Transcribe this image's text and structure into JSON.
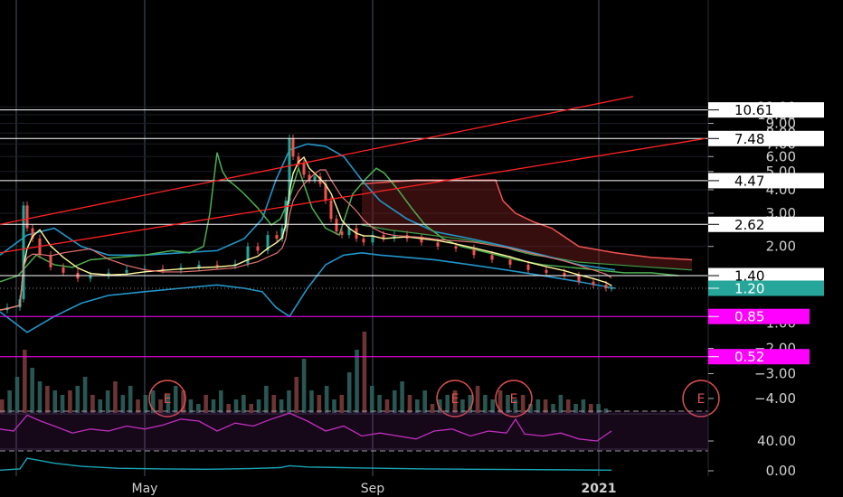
{
  "chart_data": {
    "type": "line",
    "title": "",
    "xlabel": "",
    "ylabel": "",
    "x_ticks": [
      "May",
      "Sep",
      "2021"
    ],
    "price_axis": {
      "scale": "log",
      "tick_labels": [
        "11.00",
        "10.00",
        "9.00",
        "8.00",
        "7.00",
        "6.00",
        "5.00",
        "4.00",
        "3.00",
        "2.00"
      ],
      "negative_tick_labels": [
        "−1.00",
        "−2.00",
        "−3.00",
        "−4.00"
      ]
    },
    "rsi_axis": {
      "tick_labels": [
        "40.00"
      ]
    },
    "lower_axis": {
      "tick_labels": [
        "0.00"
      ]
    },
    "horizontal_levels": [
      {
        "label": "10.61",
        "value": 10.61,
        "style": "white"
      },
      {
        "label": "7.48",
        "value": 7.48,
        "style": "white"
      },
      {
        "label": "4.47",
        "value": 4.47,
        "style": "white"
      },
      {
        "label": "2.62",
        "value": 2.62,
        "style": "white"
      },
      {
        "label": "1.40",
        "value": 1.4,
        "style": "white"
      },
      {
        "label": "1.20",
        "value": 1.2,
        "style": "teal"
      },
      {
        "label": "0.85",
        "value": 0.85,
        "style": "magenta"
      },
      {
        "label": "0.52",
        "value": 0.52,
        "style": "magenta"
      }
    ],
    "earnings_markers": [
      "E",
      "E",
      "E",
      "E"
    ],
    "price_series": {
      "name": "",
      "x": [
        0,
        8,
        22,
        26,
        30,
        36,
        44,
        56,
        70,
        86,
        100,
        120,
        140,
        160,
        180,
        200,
        220,
        240,
        260,
        274,
        285,
        296,
        306,
        312,
        316,
        320,
        324,
        330,
        336,
        342,
        348,
        354,
        360,
        366,
        372,
        378,
        386,
        394,
        402,
        412,
        424,
        436,
        450,
        466,
        484,
        504,
        524,
        544,
        564,
        584,
        604,
        624,
        640,
        656,
        670,
        676
      ],
      "values": [
        0.92,
        0.95,
        1.05,
        3.3,
        2.5,
        2.2,
        1.8,
        1.55,
        1.45,
        1.35,
        1.4,
        1.45,
        1.5,
        1.52,
        1.5,
        1.55,
        1.6,
        1.58,
        1.62,
        2.0,
        1.9,
        2.3,
        2.2,
        2.5,
        3.5,
        7.48,
        6.0,
        5.5,
        4.8,
        4.5,
        4.7,
        4.3,
        3.5,
        2.8,
        2.4,
        2.3,
        2.5,
        2.2,
        2.1,
        2.3,
        2.2,
        2.3,
        2.2,
        2.1,
        2.0,
        1.95,
        1.8,
        1.7,
        1.6,
        1.5,
        1.45,
        1.4,
        1.3,
        1.25,
        1.2,
        1.2
      ]
    },
    "green_series": {
      "name": "",
      "x": [
        0,
        20,
        40,
        60,
        80,
        100,
        130,
        160,
        190,
        210,
        225,
        232,
        240,
        246,
        252,
        260,
        270,
        285,
        300,
        310,
        320,
        330,
        345,
        360,
        375,
        390,
        405,
        416,
        425,
        440,
        455,
        470,
        490,
        510,
        530,
        550,
        570,
        600,
        630,
        660,
        690,
        720,
        750
      ],
      "values": [
        1.3,
        1.4,
        1.8,
        1.6,
        1.55,
        1.7,
        1.75,
        1.8,
        1.9,
        1.85,
        2.0,
        3.0,
        6.3,
        5.0,
        4.5,
        4.2,
        3.8,
        3.2,
        2.6,
        2.8,
        3.6,
        5.2,
        3.2,
        2.5,
        2.3,
        3.8,
        4.6,
        5.2,
        4.9,
        4.0,
        3.2,
        2.6,
        2.2,
        2.0,
        1.9,
        1.8,
        1.7,
        1.6,
        1.55,
        1.5,
        1.45,
        1.45,
        1.4
      ]
    },
    "cloud_series": {
      "name": "",
      "x": [
        400,
        430,
        460,
        490,
        520,
        548,
        556,
        570,
        590,
        610,
        640,
        680,
        720,
        765
      ],
      "upper": [
        4.3,
        4.4,
        4.5,
        4.5,
        4.5,
        4.5,
        3.5,
        3.0,
        2.7,
        2.5,
        2.0,
        1.85,
        1.75,
        1.7
      ],
      "lower": [
        2.6,
        2.45,
        2.35,
        2.25,
        2.15,
        2.05,
        2.0,
        1.9,
        1.8,
        1.75,
        1.65,
        1.6,
        1.55,
        1.5
      ]
    },
    "band_series": {
      "name": "",
      "x": [
        0,
        30,
        60,
        90,
        120,
        160,
        200,
        240,
        270,
        290,
        305,
        320,
        340,
        360,
        380,
        400,
        420,
        450,
        480,
        520,
        560,
        600,
        640,
        680
      ],
      "upper": [
        1.8,
        2.3,
        2.5,
        2.0,
        1.8,
        1.8,
        1.85,
        1.9,
        2.2,
        2.8,
        4.5,
        6.5,
        7.0,
        6.8,
        6.0,
        4.5,
        3.5,
        2.8,
        2.4,
        2.2,
        2.0,
        1.8,
        1.6,
        1.5
      ],
      "lower": [
        0.9,
        0.7,
        0.85,
        1.0,
        1.1,
        1.15,
        1.2,
        1.25,
        1.2,
        1.15,
        0.95,
        0.85,
        1.2,
        1.6,
        1.8,
        1.85,
        1.8,
        1.75,
        1.7,
        1.6,
        1.5,
        1.4,
        1.3,
        1.2
      ]
    },
    "trend_lines": [
      {
        "from": [
          0,
          2.62
        ],
        "to": [
          700,
          12.5
        ]
      },
      {
        "from": [
          0,
          1.85
        ],
        "to": [
          780,
          7.48
        ]
      }
    ],
    "rsi_levels": [
      70,
      30
    ],
    "rsi_series": {
      "name": "",
      "x": [
        0,
        15,
        30,
        45,
        60,
        80,
        100,
        120,
        140,
        160,
        180,
        200,
        220,
        240,
        260,
        280,
        300,
        320,
        340,
        360,
        380,
        400,
        420,
        440,
        460,
        480,
        500,
        520,
        540,
        560,
        570,
        580,
        600,
        620,
        640,
        660,
        676
      ],
      "values": [
        52,
        50,
        66,
        60,
        55,
        48,
        52,
        50,
        55,
        52,
        56,
        62,
        60,
        50,
        58,
        55,
        62,
        68,
        60,
        50,
        55,
        45,
        48,
        45,
        42,
        50,
        52,
        45,
        50,
        48,
        62,
        47,
        45,
        48,
        42,
        40,
        50
      ]
    },
    "lower_series": {
      "name": "",
      "x": [
        0,
        22,
        30,
        60,
        90,
        130,
        180,
        230,
        280,
        310,
        320,
        340,
        380,
        420,
        470,
        520,
        570,
        620,
        676
      ],
      "values": [
        0.05,
        0.15,
        1.0,
        0.6,
        0.35,
        0.2,
        0.15,
        0.12,
        0.18,
        0.25,
        0.4,
        0.3,
        0.25,
        0.2,
        0.15,
        0.12,
        0.1,
        0.08,
        0.05
      ]
    },
    "volume": [
      3,
      5,
      8,
      14,
      10,
      7,
      6,
      5,
      4,
      5,
      6,
      8,
      4,
      3,
      5,
      7,
      4,
      6,
      3,
      4,
      5,
      3,
      4,
      6,
      5,
      3,
      2,
      4,
      3,
      5,
      2,
      3,
      4,
      2,
      3,
      6,
      4,
      3,
      5,
      8,
      12,
      5,
      4,
      6,
      3,
      4,
      9,
      14,
      18,
      6,
      4,
      3,
      5,
      7,
      4,
      3,
      5,
      2,
      3,
      4,
      5,
      3,
      4,
      6,
      4,
      3,
      5,
      4,
      3,
      4,
      2,
      3,
      3,
      2,
      4,
      3,
      2,
      3,
      2,
      2,
      1
    ],
    "colors": {
      "price": "#26a69a",
      "green": "#4caf50",
      "band": "#2196c8",
      "cloud": "#ef5350",
      "trend": "#ff2222",
      "rsi": "#c12fbf",
      "lower": "#1aa6b7",
      "magenta_label": "#ff00ff",
      "teal_label": "#26a69a"
    }
  }
}
